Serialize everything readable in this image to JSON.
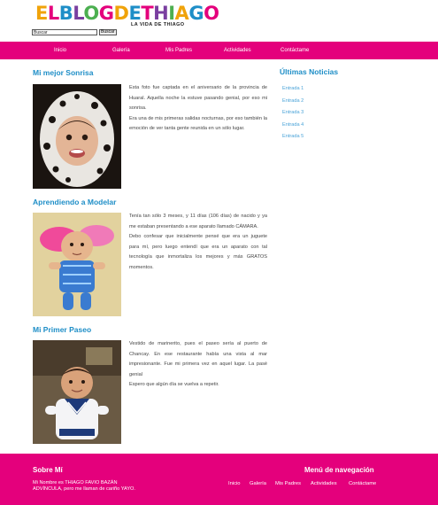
{
  "header": {
    "logo_text": "ELBLOGDETHIAGO",
    "logo_colors": [
      "#f0a30a",
      "#e4007c",
      "#1e8ec7",
      "#7a3fa0",
      "#4caf50",
      "#e4007c",
      "#f0a30a",
      "#1e8ec7",
      "#e4007c",
      "#7a3fa0",
      "#4caf50",
      "#f0a30a",
      "#1e8ec7",
      "#e4007c"
    ],
    "tagline": "LA VIDA DE THIAGO",
    "search_placeholder": "Buscar",
    "search_button": "Buscar"
  },
  "nav": {
    "items": [
      "Inicio",
      "Galería",
      "Mis Padres",
      "Actividades",
      "Contáctame"
    ],
    "background": "#e4007c"
  },
  "posts": [
    {
      "title": "Mi mejor Sonrisa",
      "paragraphs": [
        "Esta foto fue captada en el aniversario de la provincia de Huaral. Aquella noche la estuve pasando genial, por eso mi sonrisa.",
        "Era una de mis primeras salidas nocturnas, por eso también la emoción de ver tanta gente reunida en un sólo lugar."
      ]
    },
    {
      "title": "Aprendiendo a Modelar",
      "paragraphs": [
        "Tenía tan sólo 3 meses, y 11 días (106 días) de nacido y ya me estaban presentando a ese aparato llamado CÁMARA.",
        "Debo confesar que inicialmente pensé que era un juguete para mí, pero luego entendí que era un aparato con tal tecnología que inmortaliza los mejores y más GRATOS momentos."
      ]
    },
    {
      "title": "Mi Primer Paseo",
      "paragraphs": [
        "Vestido de marinerito, pues el paseo sería al puerto de Chancay. En ese restaurante había una vista al mar impresionante. Fue mi primera vez en aquel lugar. La pasé genial",
        "Espero que algún día se vuelva a repetir."
      ]
    }
  ],
  "sidebar": {
    "title": "Últimas Noticias",
    "items": [
      "Entrada 1",
      "Entrada 2",
      "Entrada 3",
      "Entrada 4",
      "Entrada 5"
    ]
  },
  "footer": {
    "about_title": "Sobre Mí",
    "about_text": "Mi Nombre es THIAGO FAVIO BAZÁN ADVÍNCULA, pero me llaman de cariño YAYO.",
    "nav_title": "Menú de navegación",
    "nav_items": [
      "Inicio",
      "Galería",
      "Mis Padres",
      "Actividades",
      "Contáctame"
    ]
  },
  "colors": {
    "accent": "#e4007c",
    "title_blue": "#1e8ec7",
    "link_blue": "#4aa3d8"
  }
}
